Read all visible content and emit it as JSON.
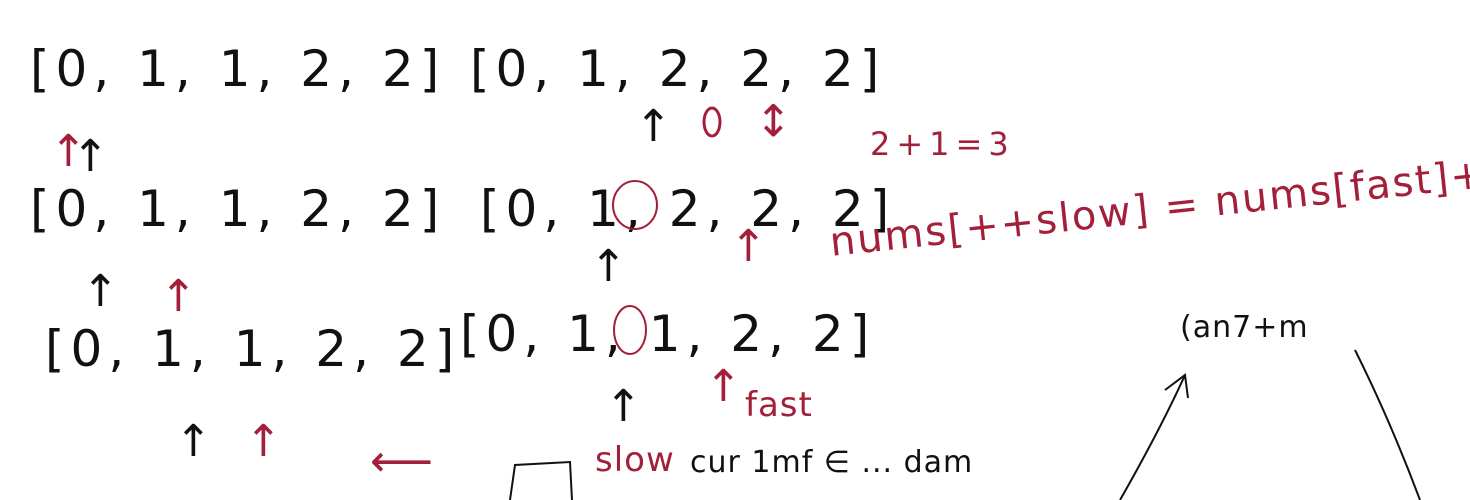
{
  "rows": [
    {
      "left": "[0, 1, 1, 2, 2]",
      "right": "[0, 1, 2, 2, 2]"
    },
    {
      "left": "[0, 1, 1, 2, 2]",
      "right": "[0, 1, 2, 2, 2]"
    },
    {
      "left": "[0, 1, 1, 2, 2]",
      "right": "[0, 1, 1, 2, 2]"
    }
  ],
  "notes": {
    "sum": "2+1=3",
    "assign": "nums[++slow] = nums[fast]++",
    "fast": "fast",
    "slow": "slow",
    "scribble": "cur 1mf ∈ ... dam",
    "corner": "(an7+m"
  },
  "colors": {
    "ink": "#111111",
    "red_ink": "#a3203a"
  }
}
